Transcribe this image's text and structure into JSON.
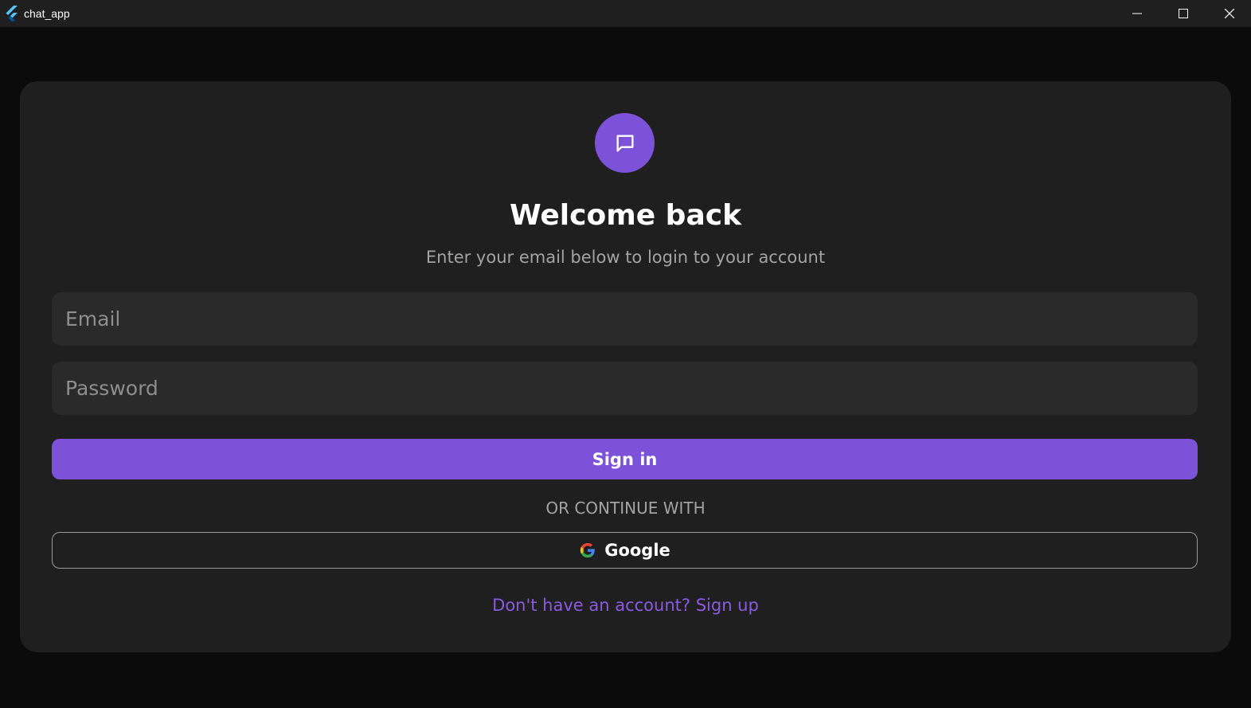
{
  "window": {
    "title": "chat_app",
    "icons": {
      "app": "flutter-logo-icon",
      "minimize": "minimize-icon",
      "maximize": "maximize-icon",
      "close": "close-icon"
    }
  },
  "login": {
    "logo_icon": "chat-bubble-icon",
    "title": "Welcome back",
    "subtitle": "Enter your email below to login to your account",
    "email_placeholder": "Email",
    "password_placeholder": "Password",
    "signin_label": "Sign in",
    "divider_text": "OR CONTINUE WITH",
    "google_label": "Google",
    "google_icon": "google-icon",
    "signup_text": "Don't have an account? Sign up"
  },
  "colors": {
    "accent": "#7c52d8",
    "link": "#8a5ae0",
    "card_bg": "#1f1f1f",
    "page_bg": "#0b0b0b",
    "field_bg": "#2a2a2a"
  }
}
